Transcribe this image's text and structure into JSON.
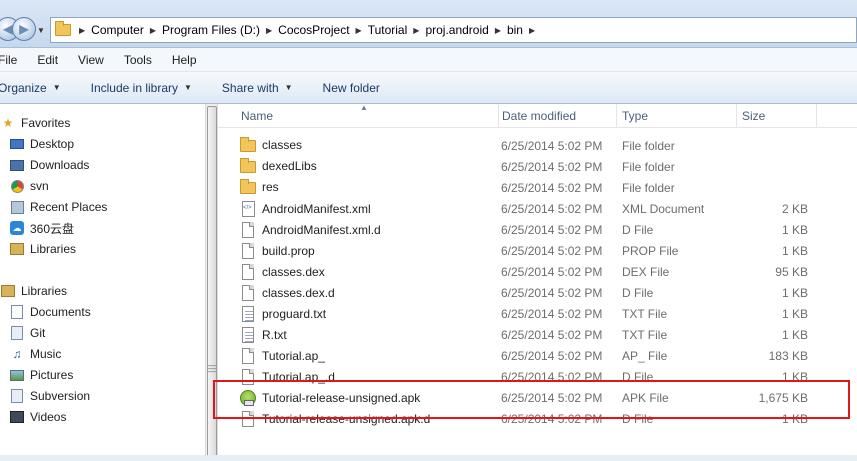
{
  "address": {
    "crumbs": [
      "Computer",
      "Program Files (D:)",
      "CocosProject",
      "Tutorial",
      "proj.android",
      "bin"
    ]
  },
  "menubar": {
    "items": [
      "File",
      "Edit",
      "View",
      "Tools",
      "Help"
    ]
  },
  "toolbar": {
    "organize": "Organize",
    "include": "Include in library",
    "share": "Share with",
    "newfolder": "New folder"
  },
  "navpane": {
    "favorites_label": "Favorites",
    "favorites": [
      {
        "label": "Desktop",
        "icon": "desktop-icon"
      },
      {
        "label": "Downloads",
        "icon": "downloads-icon"
      },
      {
        "label": "svn",
        "icon": "chrome-icon"
      },
      {
        "label": "Recent Places",
        "icon": "recent-places-icon"
      },
      {
        "label": "360云盘",
        "icon": "cloud-drive-icon"
      },
      {
        "label": "Libraries",
        "icon": "libraries-icon"
      }
    ],
    "libraries_label": "Libraries",
    "libraries": [
      {
        "label": "Documents",
        "icon": "documents-icon"
      },
      {
        "label": "Git",
        "icon": "git-icon"
      },
      {
        "label": "Music",
        "icon": "music-icon"
      },
      {
        "label": "Pictures",
        "icon": "pictures-icon"
      },
      {
        "label": "Subversion",
        "icon": "subversion-icon"
      },
      {
        "label": "Videos",
        "icon": "videos-icon"
      }
    ]
  },
  "columns": {
    "name": "Name",
    "date": "Date modified",
    "type": "Type",
    "size": "Size"
  },
  "files": [
    {
      "name": "classes",
      "date": "6/25/2014 5:02 PM",
      "type": "File folder",
      "size": "",
      "icon": "folder"
    },
    {
      "name": "dexedLibs",
      "date": "6/25/2014 5:02 PM",
      "type": "File folder",
      "size": "",
      "icon": "folder"
    },
    {
      "name": "res",
      "date": "6/25/2014 5:02 PM",
      "type": "File folder",
      "size": "",
      "icon": "folder"
    },
    {
      "name": "AndroidManifest.xml",
      "date": "6/25/2014 5:02 PM",
      "type": "XML Document",
      "size": "2 KB",
      "icon": "xml"
    },
    {
      "name": "AndroidManifest.xml.d",
      "date": "6/25/2014 5:02 PM",
      "type": "D File",
      "size": "1 KB",
      "icon": "doc"
    },
    {
      "name": "build.prop",
      "date": "6/25/2014 5:02 PM",
      "type": "PROP File",
      "size": "1 KB",
      "icon": "doc"
    },
    {
      "name": "classes.dex",
      "date": "6/25/2014 5:02 PM",
      "type": "DEX File",
      "size": "95 KB",
      "icon": "doc"
    },
    {
      "name": "classes.dex.d",
      "date": "6/25/2014 5:02 PM",
      "type": "D File",
      "size": "1 KB",
      "icon": "doc"
    },
    {
      "name": "proguard.txt",
      "date": "6/25/2014 5:02 PM",
      "type": "TXT File",
      "size": "1 KB",
      "icon": "txt"
    },
    {
      "name": "R.txt",
      "date": "6/25/2014 5:02 PM",
      "type": "TXT File",
      "size": "1 KB",
      "icon": "txt"
    },
    {
      "name": "Tutorial.ap_",
      "date": "6/25/2014 5:02 PM",
      "type": "AP_ File",
      "size": "183 KB",
      "icon": "doc"
    },
    {
      "name": "Tutorial.ap_.d",
      "date": "6/25/2014 5:02 PM",
      "type": "D File",
      "size": "1 KB",
      "icon": "doc"
    },
    {
      "name": "Tutorial-release-unsigned.apk",
      "date": "6/25/2014 5:02 PM",
      "type": "APK File",
      "size": "1,675 KB",
      "icon": "apk"
    },
    {
      "name": "Tutorial-release-unsigned.apk.d",
      "date": "6/25/2014 5:02 PM",
      "type": "D File",
      "size": "1 KB",
      "icon": "doc"
    }
  ],
  "colors": {
    "highlight": "#e3141a"
  }
}
